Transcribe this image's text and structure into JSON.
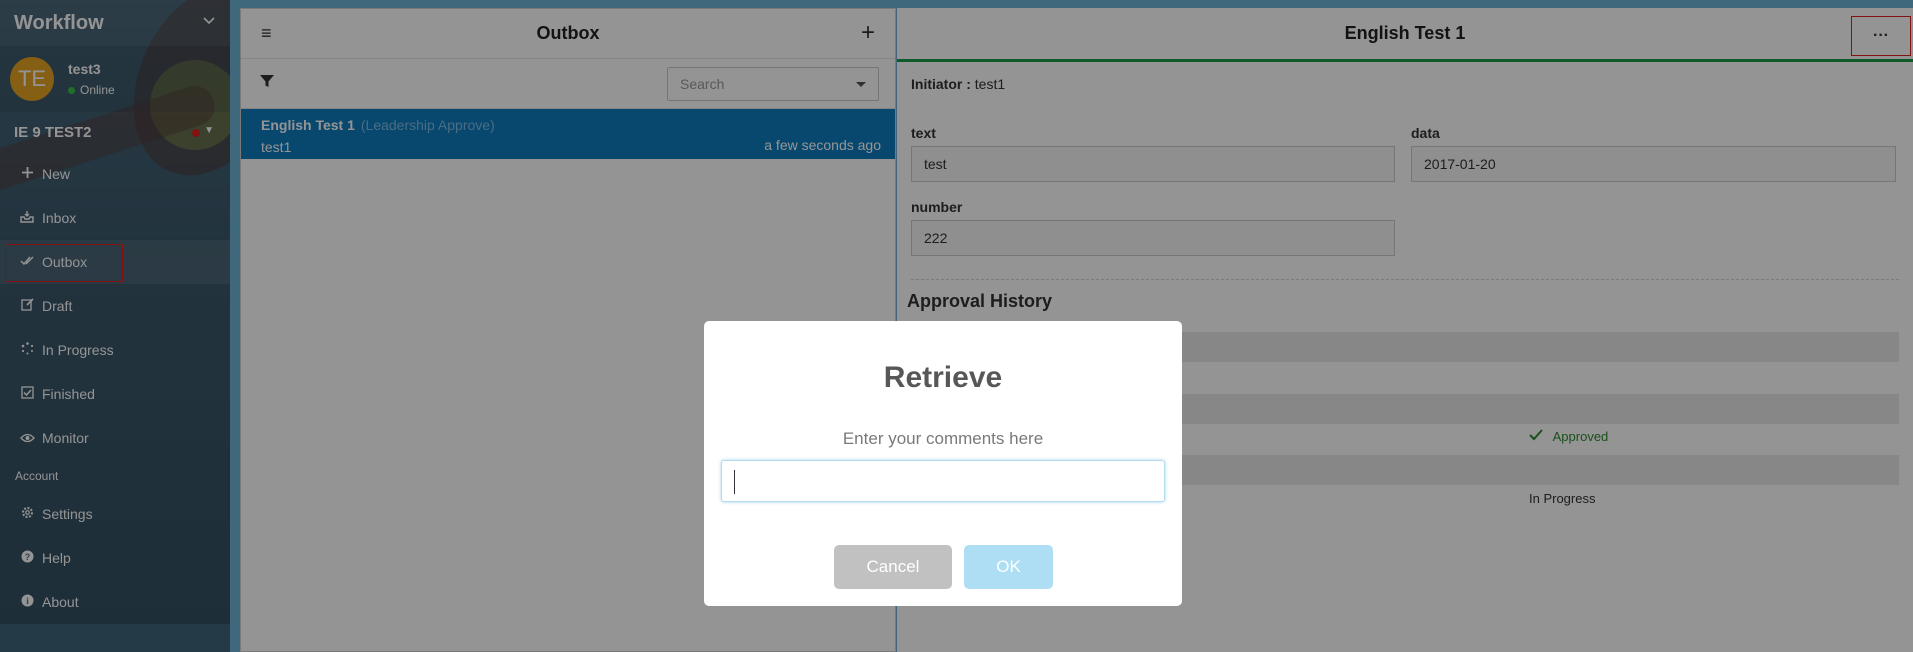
{
  "sidebar": {
    "app_title": "Workflow",
    "user": {
      "initials": "TE",
      "name": "test3",
      "status": "Online"
    },
    "tenant": "IE 9 TEST2",
    "nav": [
      {
        "label": "New",
        "icon": "plus-icon"
      },
      {
        "label": "Inbox",
        "icon": "inbox-icon"
      },
      {
        "label": "Outbox",
        "icon": "double-check-icon",
        "active": true
      },
      {
        "label": "Draft",
        "icon": "edit-icon"
      },
      {
        "label": "In Progress",
        "icon": "spinner-icon"
      },
      {
        "label": "Finished",
        "icon": "checkbox-icon"
      },
      {
        "label": "Monitor",
        "icon": "eye-icon"
      }
    ],
    "account_section": "Account",
    "account_nav": [
      {
        "label": "Settings",
        "icon": "gear-icon"
      },
      {
        "label": "Help",
        "icon": "help-icon"
      },
      {
        "label": "About",
        "icon": "info-icon"
      }
    ]
  },
  "outbox": {
    "title": "Outbox",
    "search_placeholder": "Search",
    "items": [
      {
        "title": "English Test 1",
        "stage": "(Leadership Approve)",
        "initiator": "test1",
        "time": "a few seconds ago"
      }
    ]
  },
  "detail": {
    "title": "English Test 1",
    "more_label": "···",
    "initiator_label": "Initiator :",
    "initiator_value": "test1",
    "fields": {
      "text_label": "text",
      "text_value": "test",
      "data_label": "data",
      "data_value": "2017-01-20",
      "number_label": "number",
      "number_value": "222"
    },
    "approval_history_title": "Approval History",
    "history": [
      {
        "status": "Approved",
        "status_color": "#2e8b2e"
      },
      {
        "status": "In Progress",
        "status_color": "#333333"
      }
    ]
  },
  "dialog": {
    "title": "Retrieve",
    "message": "Enter your comments here",
    "input_value": "",
    "cancel_label": "Cancel",
    "ok_label": "OK"
  },
  "colors": {
    "accent_blue": "#0e7dc0",
    "ok_button": "#aedef4",
    "cancel_button": "#c1c1c1",
    "highlight_red": "#e02020",
    "header_green": "#1c9a4a"
  }
}
